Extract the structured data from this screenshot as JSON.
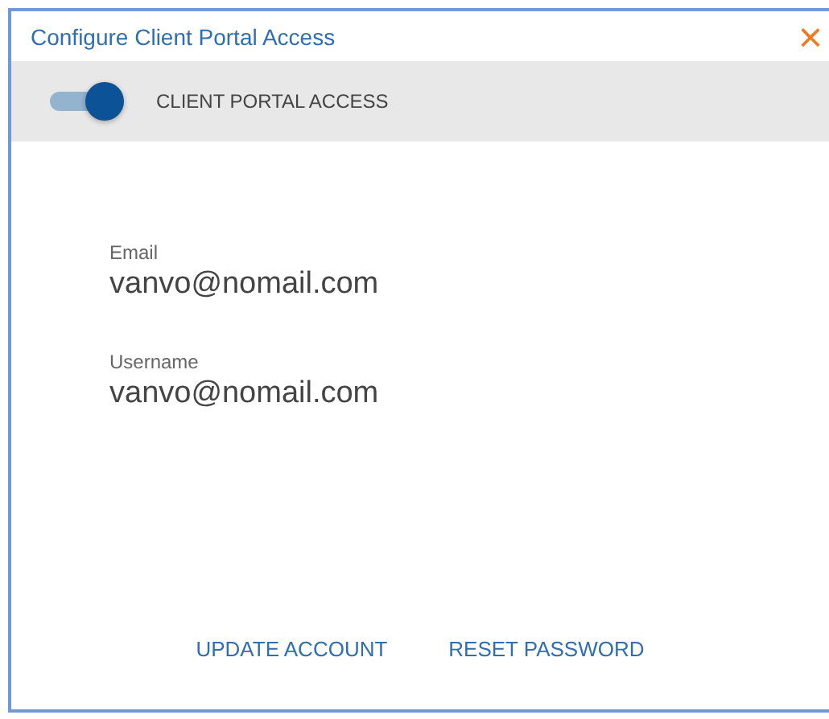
{
  "dialog": {
    "title": "Configure Client Portal Access",
    "close": "×"
  },
  "toggle": {
    "label": "CLIENT PORTAL ACCESS",
    "on": true
  },
  "fields": [
    {
      "label": "Email",
      "value": "vanvo@nomail.com"
    },
    {
      "label": "Username",
      "value": "vanvo@nomail.com"
    }
  ],
  "buttons": [
    "UPDATE ACCOUNT",
    "RESET PASSWORD"
  ]
}
